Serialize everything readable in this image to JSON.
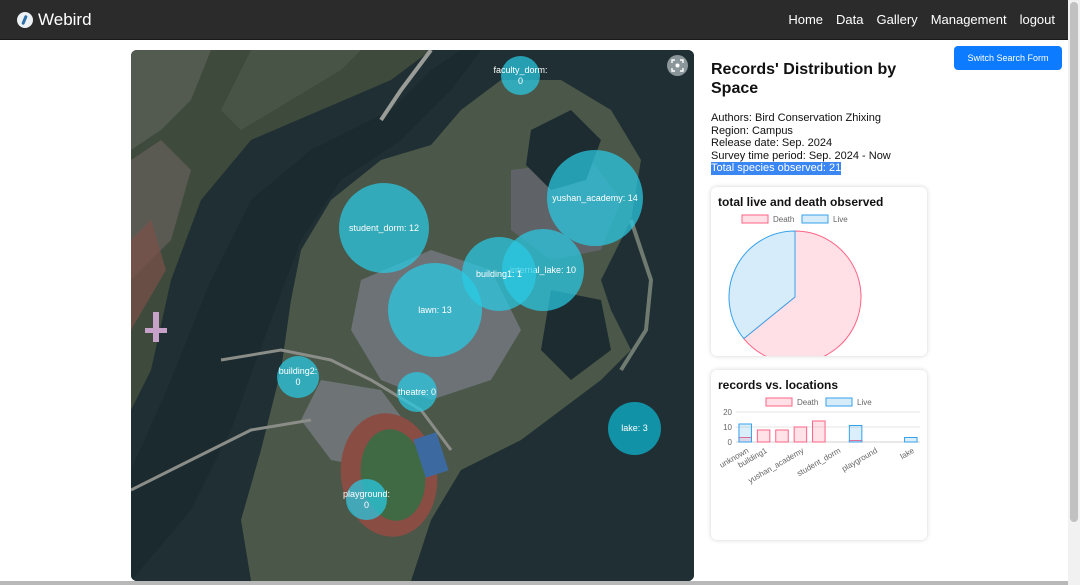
{
  "app": {
    "brand": "Webird"
  },
  "nav": {
    "home": "Home",
    "data": "Data",
    "gallery": "Gallery",
    "management": "Management",
    "logout": "logout"
  },
  "map": {
    "fullscreen_icon": "expand-icon",
    "bubbles": [
      {
        "name": "faculty_dorm",
        "label": "faculty_dorm:\n0"
      },
      {
        "name": "yushan_academy",
        "label": "yushan_academy: 14"
      },
      {
        "name": "student_dorm",
        "label": "student_dorm: 12"
      },
      {
        "name": "internal_lake",
        "label": "internal_lake: 10"
      },
      {
        "name": "building1",
        "label": "building1: 1"
      },
      {
        "name": "lawn",
        "label": "lawn: 13"
      },
      {
        "name": "building2",
        "label": "building2:\n0"
      },
      {
        "name": "theatre",
        "label": "theatre: 0"
      },
      {
        "name": "lake",
        "label": "lake: 3"
      },
      {
        "name": "playground",
        "label": "playground:\n0"
      }
    ]
  },
  "info": {
    "title": "Records' Distribution by Space",
    "authors": "Authors: Bird Conservation Zhixing",
    "region": "Region: Campus",
    "release": "Release date: Sep. 2024",
    "period": "Survey time period: Sep. 2024 - Now",
    "species": "Total species observed: 21"
  },
  "switch_button": "Switch Search Form",
  "colors": {
    "death": "#ff6384",
    "live": "#36a2eb",
    "bubble": "#29cbe5",
    "accent": "#0d7bff"
  },
  "chart_data": [
    {
      "type": "pie",
      "title": "total live and death observed",
      "legend": [
        "Death",
        "Live"
      ],
      "legend_position": "top",
      "values": [
        34,
        19
      ]
    },
    {
      "type": "bar",
      "title": "records vs. locations",
      "legend": [
        "Death",
        "Live"
      ],
      "legend_position": "top",
      "categories": [
        "unknown",
        "building1",
        "",
        "yushan_academy",
        "",
        "student_dorm",
        "",
        "playground",
        "",
        "lake"
      ],
      "series": [
        {
          "name": "Death",
          "values": [
            3,
            8,
            8,
            10,
            14,
            0,
            1,
            0,
            0,
            0
          ]
        },
        {
          "name": "Live",
          "values": [
            12,
            0,
            0,
            0,
            0,
            0,
            11,
            0,
            0,
            3
          ]
        }
      ],
      "ylim": [
        0,
        20
      ],
      "yticks": [
        0,
        10,
        20
      ],
      "grid": true
    }
  ]
}
